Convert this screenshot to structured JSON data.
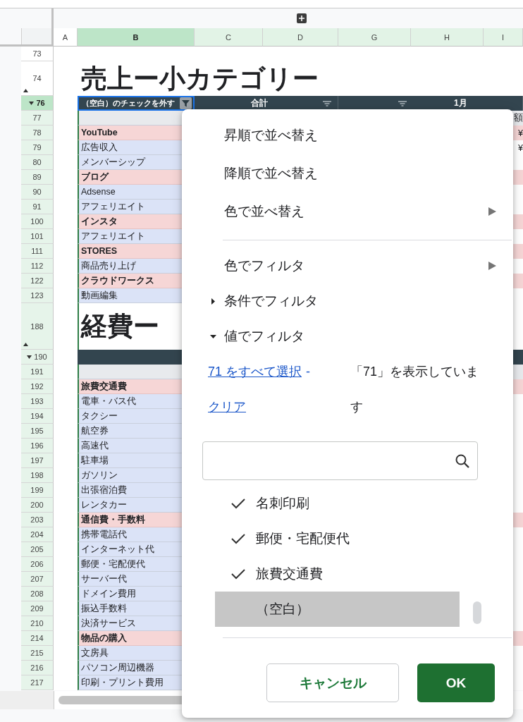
{
  "columns": [
    {
      "label": "A",
      "selected": false,
      "highlighted": false
    },
    {
      "label": "B",
      "selected": true,
      "highlighted": true
    },
    {
      "label": "C",
      "selected": false,
      "highlighted": true
    },
    {
      "label": "D",
      "selected": false,
      "highlighted": true
    },
    {
      "label": "G",
      "selected": false,
      "highlighted": true
    },
    {
      "label": "H",
      "selected": false,
      "highlighted": true
    },
    {
      "label": "I",
      "selected": false,
      "highlighted": true
    }
  ],
  "rows": [
    {
      "number": "73",
      "kind": "blank",
      "selected": false,
      "highlighted": false
    },
    {
      "number": "74",
      "kind": "title",
      "text": "売上ー小カテゴリー",
      "collapse_marker": true,
      "selected": false,
      "highlighted": false
    },
    {
      "number": "76",
      "kind": "header",
      "expand_marker": true,
      "selected": true,
      "highlighted": true,
      "cells": [
        {
          "text": "（空白）のチェックを外す",
          "filtered": true,
          "selected": true
        },
        {
          "text": "合計",
          "filtered": false,
          "selected": false
        },
        {
          "text": "1月",
          "filtered": false,
          "selected": false
        }
      ]
    },
    {
      "number": "77",
      "kind": "subheader",
      "edge": "額",
      "selected": false,
      "highlighted": true
    },
    {
      "number": "78",
      "kind": "category",
      "text": "YouTube",
      "edge": "¥",
      "selected": false,
      "highlighted": true
    },
    {
      "number": "79",
      "kind": "item",
      "text": "広告収入",
      "edge": "¥",
      "selected": false,
      "highlighted": true
    },
    {
      "number": "80",
      "kind": "item",
      "text": "メンバーシップ",
      "selected": false,
      "highlighted": true
    },
    {
      "number": "89",
      "kind": "category",
      "text": "ブログ",
      "selected": false,
      "highlighted": true
    },
    {
      "number": "90",
      "kind": "item",
      "text": "Adsense",
      "selected": false,
      "highlighted": true
    },
    {
      "number": "91",
      "kind": "item",
      "text": "アフェリエイト",
      "selected": false,
      "highlighted": true
    },
    {
      "number": "100",
      "kind": "category",
      "text": "インスタ",
      "selected": false,
      "highlighted": true
    },
    {
      "number": "101",
      "kind": "item",
      "text": "アフェリエイト",
      "selected": false,
      "highlighted": true
    },
    {
      "number": "111",
      "kind": "category",
      "text": "STORES",
      "selected": false,
      "highlighted": true
    },
    {
      "number": "112",
      "kind": "item",
      "text": "商品売り上げ",
      "selected": false,
      "highlighted": true
    },
    {
      "number": "122",
      "kind": "category",
      "text": "クラウドワークス",
      "selected": false,
      "highlighted": true
    },
    {
      "number": "123",
      "kind": "item",
      "text": "動画編集",
      "selected": false,
      "highlighted": true
    },
    {
      "number": "188",
      "kind": "title",
      "text": "経費ー",
      "collapse_marker": true,
      "selected": false,
      "highlighted": true
    },
    {
      "number": "190",
      "kind": "header",
      "expand_marker": true,
      "selected": false,
      "highlighted": true
    },
    {
      "number": "191",
      "kind": "subheader",
      "selected": false,
      "highlighted": true
    },
    {
      "number": "192",
      "kind": "category",
      "text": "旅費交通費",
      "selected": false,
      "highlighted": true
    },
    {
      "number": "193",
      "kind": "item",
      "text": "電車・バス代",
      "selected": false,
      "highlighted": true
    },
    {
      "number": "194",
      "kind": "item",
      "text": "タクシー",
      "selected": false,
      "highlighted": true
    },
    {
      "number": "195",
      "kind": "item",
      "text": "航空券",
      "selected": false,
      "highlighted": true
    },
    {
      "number": "196",
      "kind": "item",
      "text": "高速代",
      "selected": false,
      "highlighted": true
    },
    {
      "number": "197",
      "kind": "item",
      "text": "駐車場",
      "selected": false,
      "highlighted": true
    },
    {
      "number": "198",
      "kind": "item",
      "text": "ガソリン",
      "selected": false,
      "highlighted": true
    },
    {
      "number": "199",
      "kind": "item",
      "text": "出張宿泊費",
      "selected": false,
      "highlighted": true
    },
    {
      "number": "200",
      "kind": "item",
      "text": "レンタカー",
      "selected": false,
      "highlighted": true
    },
    {
      "number": "203",
      "kind": "category",
      "text": "通信費・手数料",
      "selected": false,
      "highlighted": true
    },
    {
      "number": "204",
      "kind": "item",
      "text": "携帯電話代",
      "selected": false,
      "highlighted": true
    },
    {
      "number": "205",
      "kind": "item",
      "text": "インターネット代",
      "selected": false,
      "highlighted": true
    },
    {
      "number": "206",
      "kind": "item",
      "text": "郵便・宅配便代",
      "selected": false,
      "highlighted": true
    },
    {
      "number": "207",
      "kind": "item",
      "text": "サーバー代",
      "selected": false,
      "highlighted": true
    },
    {
      "number": "208",
      "kind": "item",
      "text": "ドメイン費用",
      "selected": false,
      "highlighted": true
    },
    {
      "number": "209",
      "kind": "item",
      "text": "振込手数料",
      "selected": false,
      "highlighted": true
    },
    {
      "number": "210",
      "kind": "item",
      "text": "決済サービス",
      "selected": false,
      "highlighted": true
    },
    {
      "number": "214",
      "kind": "category",
      "text": "物品の購入",
      "selected": false,
      "highlighted": true
    },
    {
      "number": "215",
      "kind": "item",
      "text": "文房具",
      "selected": false,
      "highlighted": true
    },
    {
      "number": "216",
      "kind": "item",
      "text": "パソコン周辺機器",
      "selected": false,
      "highlighted": true
    },
    {
      "number": "217",
      "kind": "item",
      "text": "印刷・プリント費用",
      "selected": false,
      "highlighted": true
    }
  ],
  "filter_menu": {
    "sort_items": [
      {
        "label": "昇順で並べ替え",
        "kind": "action"
      },
      {
        "label": "降順で並べ替え",
        "kind": "action"
      },
      {
        "label": "色で並べ替え",
        "kind": "submenu"
      }
    ],
    "filter_items": [
      {
        "label": "色でフィルタ",
        "kind": "submenu"
      },
      {
        "label": "条件でフィルタ",
        "kind": "section",
        "expanded": false
      },
      {
        "label": "値でフィルタ",
        "kind": "section",
        "expanded": true
      }
    ],
    "select_all_link": "71 をすべて選択",
    "separator": "-",
    "clear_link": "クリア",
    "status": "「71」を表示しています",
    "values": [
      {
        "label": "名刺印刷",
        "checked": true,
        "selected": false
      },
      {
        "label": "郵便・宅配便代",
        "checked": true,
        "selected": false
      },
      {
        "label": "旅費交通費",
        "checked": true,
        "selected": false
      },
      {
        "label": "（空白）",
        "checked": false,
        "selected": true
      }
    ],
    "buttons": [
      {
        "label": "キャンセル",
        "kind": "secondary"
      },
      {
        "label": "OK",
        "kind": "primary"
      }
    ]
  }
}
